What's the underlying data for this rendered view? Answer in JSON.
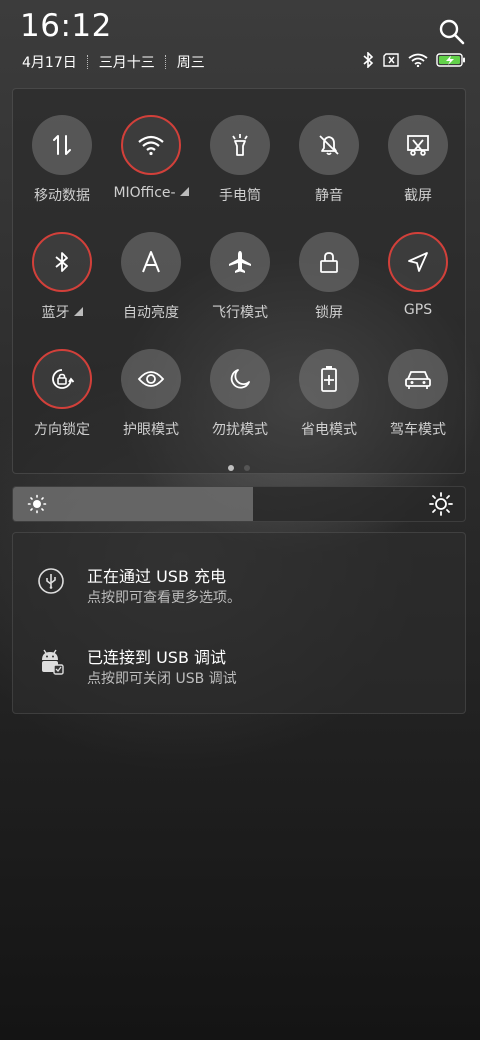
{
  "status": {
    "time": "16:12",
    "date": "4月17日",
    "lunar": "三月十三",
    "weekday": "周三",
    "icons": [
      "bluetooth-icon",
      "sim-none-icon",
      "wifi-icon",
      "battery-charging-icon"
    ]
  },
  "quick_settings": {
    "page_count": 2,
    "active_page": 0,
    "accent_color": "#d2403a",
    "tiles": [
      {
        "label": "移动数据",
        "icon": "mobile-data-icon",
        "active": false
      },
      {
        "label": "MIOffice-",
        "icon": "wifi-icon",
        "active": true,
        "has_menu": true
      },
      {
        "label": "手电筒",
        "icon": "flashlight-icon",
        "active": false
      },
      {
        "label": "静音",
        "icon": "bell-off-icon",
        "active": false
      },
      {
        "label": "截屏",
        "icon": "screenshot-icon",
        "active": false
      },
      {
        "label": "蓝牙",
        "icon": "bluetooth-icon",
        "active": true,
        "has_menu": true
      },
      {
        "label": "自动亮度",
        "icon": "auto-brightness-icon",
        "active": false
      },
      {
        "label": "飞行模式",
        "icon": "airplane-icon",
        "active": false
      },
      {
        "label": "锁屏",
        "icon": "lock-icon",
        "active": false
      },
      {
        "label": "GPS",
        "icon": "location-arrow-icon",
        "active": true
      },
      {
        "label": "方向锁定",
        "icon": "rotation-lock-icon",
        "active": true
      },
      {
        "label": "护眼模式",
        "icon": "eye-icon",
        "active": false
      },
      {
        "label": "勿扰模式",
        "icon": "moon-icon",
        "active": false
      },
      {
        "label": "省电模式",
        "icon": "battery-saver-icon",
        "active": false
      },
      {
        "label": "驾车模式",
        "icon": "car-icon",
        "active": false
      }
    ]
  },
  "brightness": {
    "level": 0.53
  },
  "notifications": [
    {
      "title": "正在通过 USB 充电",
      "subtitle": "点按即可查看更多选项。",
      "icon": "usb-charging-icon"
    },
    {
      "title": "已连接到 USB 调试",
      "subtitle": "点按即可关闭 USB 调试",
      "icon": "android-debug-icon"
    }
  ]
}
